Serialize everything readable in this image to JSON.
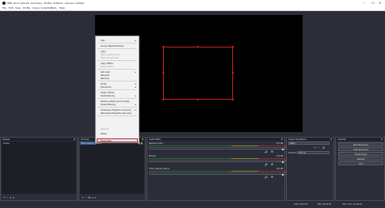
{
  "window": {
    "title": "OBS 24.0.3 (64-bit, windows) - Profile: Untitled - Scenes: Untitled",
    "controls": [
      "–",
      "☐",
      "✕"
    ]
  },
  "menubar": [
    "File",
    "Edit",
    "View",
    "Profile",
    "Scene Collection",
    "Tools",
    "Help"
  ],
  "context_menu": {
    "items": [
      {
        "label": "Add",
        "submenu": true
      },
      {
        "label": "Group Selected Items"
      },
      {
        "label": "Copy"
      },
      {
        "label": "Paste (Reference)"
      },
      {
        "label": "Paste (Duplicate)"
      },
      {
        "label": "Copy Filters"
      },
      {
        "label": "Paste Filters"
      },
      {
        "label": "Set Color",
        "submenu": true
      },
      {
        "label": "Rename"
      },
      {
        "label": "Remove"
      },
      {
        "label": "Order",
        "submenu": true
      },
      {
        "label": "Transform",
        "submenu": true
      },
      {
        "label": "Hide in Mixer"
      },
      {
        "label": "Deinterlacing",
        "submenu": true
      },
      {
        "label": "Resize output (source size)"
      },
      {
        "label": "Scale Filtering",
        "submenu": true
      },
      {
        "label": "Fullscreen Projector (Source)",
        "submenu": true
      },
      {
        "label": "Windowed Projector (Source)"
      },
      {
        "label": "Interact"
      },
      {
        "label": "Filters"
      },
      {
        "label": "Properties"
      }
    ]
  },
  "panels": {
    "scenes": {
      "title": "Scenes",
      "items": [
        "Scene"
      ],
      "controls": "+ −  ∧ ∨"
    },
    "sources": {
      "title": "Sources",
      "items": [
        "Video Capture Device"
      ],
      "controls": "+ − ⚙ ∧ ∨"
    },
    "mixer": {
      "title": "Audio Mixer",
      "channels": [
        {
          "name": "Desktop Audio",
          "db": "0.0 dB"
        },
        {
          "name": "Mic/Aux",
          "db": "0.0 dB"
        },
        {
          "name": "Video Capture Device",
          "db": "0.0 dB"
        }
      ]
    },
    "transitions": {
      "title": "Scene Transitions",
      "selected": "Fade",
      "duration_label": "Duration",
      "duration_value": "300 ms"
    },
    "controls": {
      "title": "Controls",
      "buttons": [
        "Start Streaming",
        "Start Recording",
        "Studio Mode",
        "Settings",
        "Exit"
      ]
    }
  },
  "statusbar": {
    "live": "LIVE: 00:00:00",
    "rec": "REC: 00:00:00",
    "cpu": "CPU: 0.9%, 30.00 fps"
  },
  "colors": {
    "accent": "#d21e1e",
    "background": "#2b2e38",
    "canvas": "#000000"
  }
}
